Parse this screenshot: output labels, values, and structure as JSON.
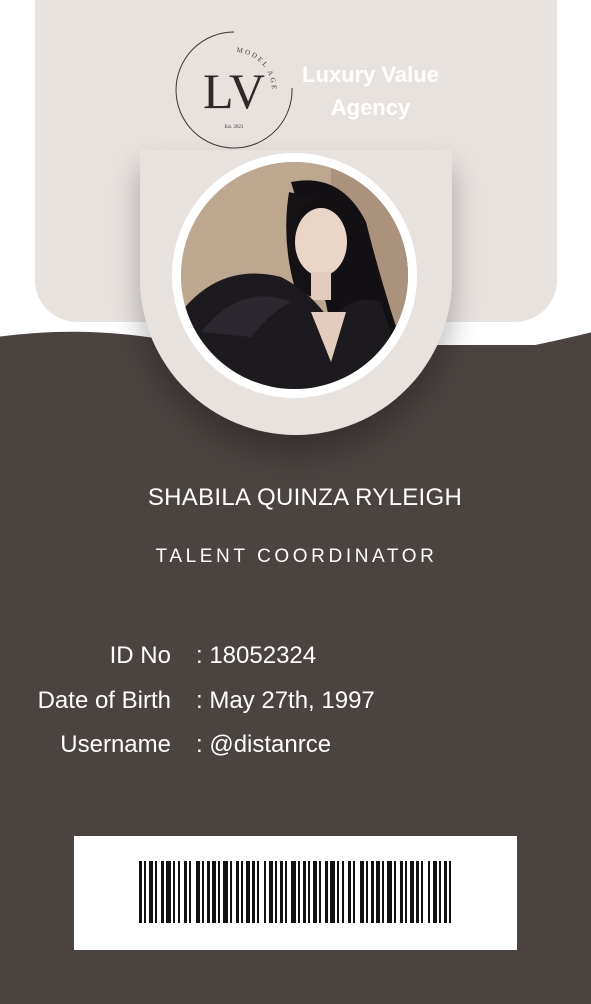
{
  "logo": {
    "monogram": "LV",
    "arc_text": "MODEL AGENCY",
    "est": "Est. 2023"
  },
  "agency": {
    "line1": "Luxury Value",
    "line2": "Agency"
  },
  "person": {
    "name": "SHABILA QUINZA RYLEIGH",
    "title": "TALENT COORDINATOR"
  },
  "info": [
    {
      "label": "ID No",
      "value": ": 18052324"
    },
    {
      "label": "Date of Birth",
      "value": ": May 27th, 1997"
    },
    {
      "label": "Username",
      "value": ": @distanrce"
    }
  ],
  "colors": {
    "brown": "#4a4340",
    "beige": "#e8e2df",
    "white": "#ffffff"
  }
}
